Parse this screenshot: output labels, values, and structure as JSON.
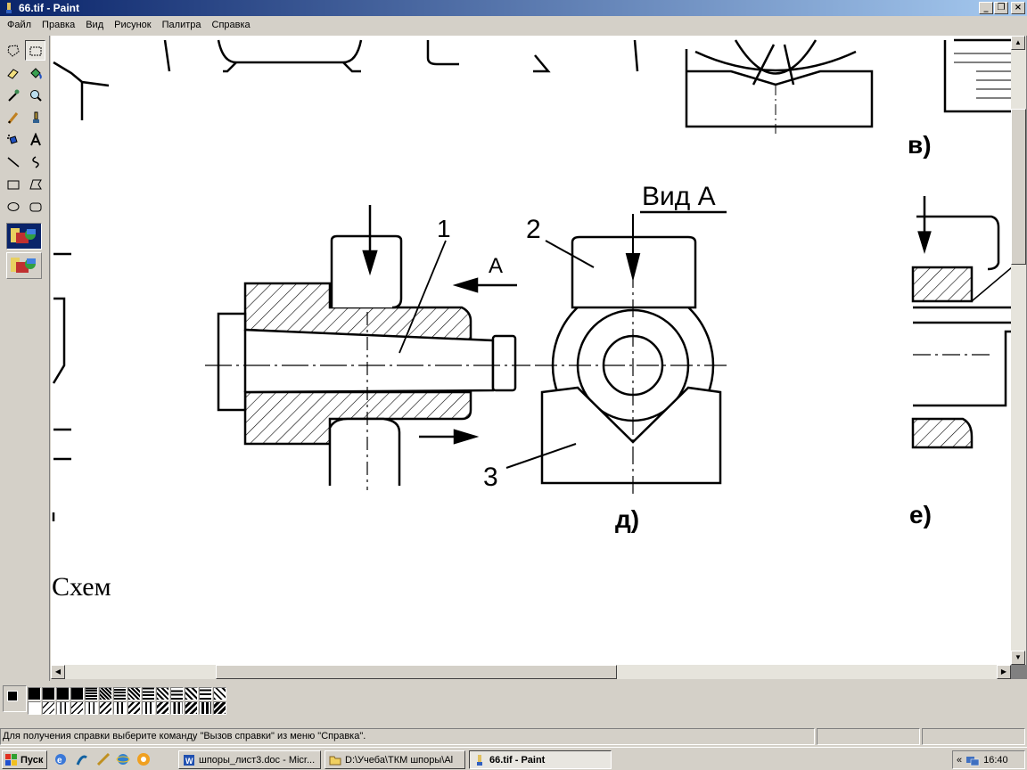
{
  "window": {
    "title": "66.tif - Paint"
  },
  "window_buttons": {
    "minimize": "_",
    "maximize": "❐",
    "close": "×"
  },
  "menu": [
    "Файл",
    "Правка",
    "Вид",
    "Рисунок",
    "Палитра",
    "Справка"
  ],
  "tools": [
    "free-select",
    "rect-select",
    "eraser",
    "fill",
    "color-picker",
    "magnifier",
    "pencil",
    "brush",
    "airbrush",
    "text",
    "line",
    "curve",
    "rectangle",
    "polygon",
    "ellipse",
    "rounded-rectangle"
  ],
  "active_tool": "rect-select",
  "drawing": {
    "view_label": "Вид А",
    "arrow_label": "А",
    "part_numbers": [
      "1",
      "2",
      "3"
    ],
    "caption_v": "в)",
    "caption_d": "д)",
    "caption_e": "е)",
    "text_fragment": "Схем"
  },
  "palette": {
    "foreground": "#000000",
    "background": "#ffffff",
    "pattern_count": 28
  },
  "status": {
    "help_text": "Для получения справки выберите команду \"Вызов справки\" из меню \"Справка\"."
  },
  "taskbar": {
    "start_label": "Пуск",
    "tasks": [
      "шпоры_лист3.doc - Micr...",
      "D:\\Учеба\\ТКМ шпоры\\Al",
      "66.tif - Paint"
    ],
    "active_task": "66.tif - Paint",
    "tray_chevron": "«",
    "clock": "16:40"
  }
}
